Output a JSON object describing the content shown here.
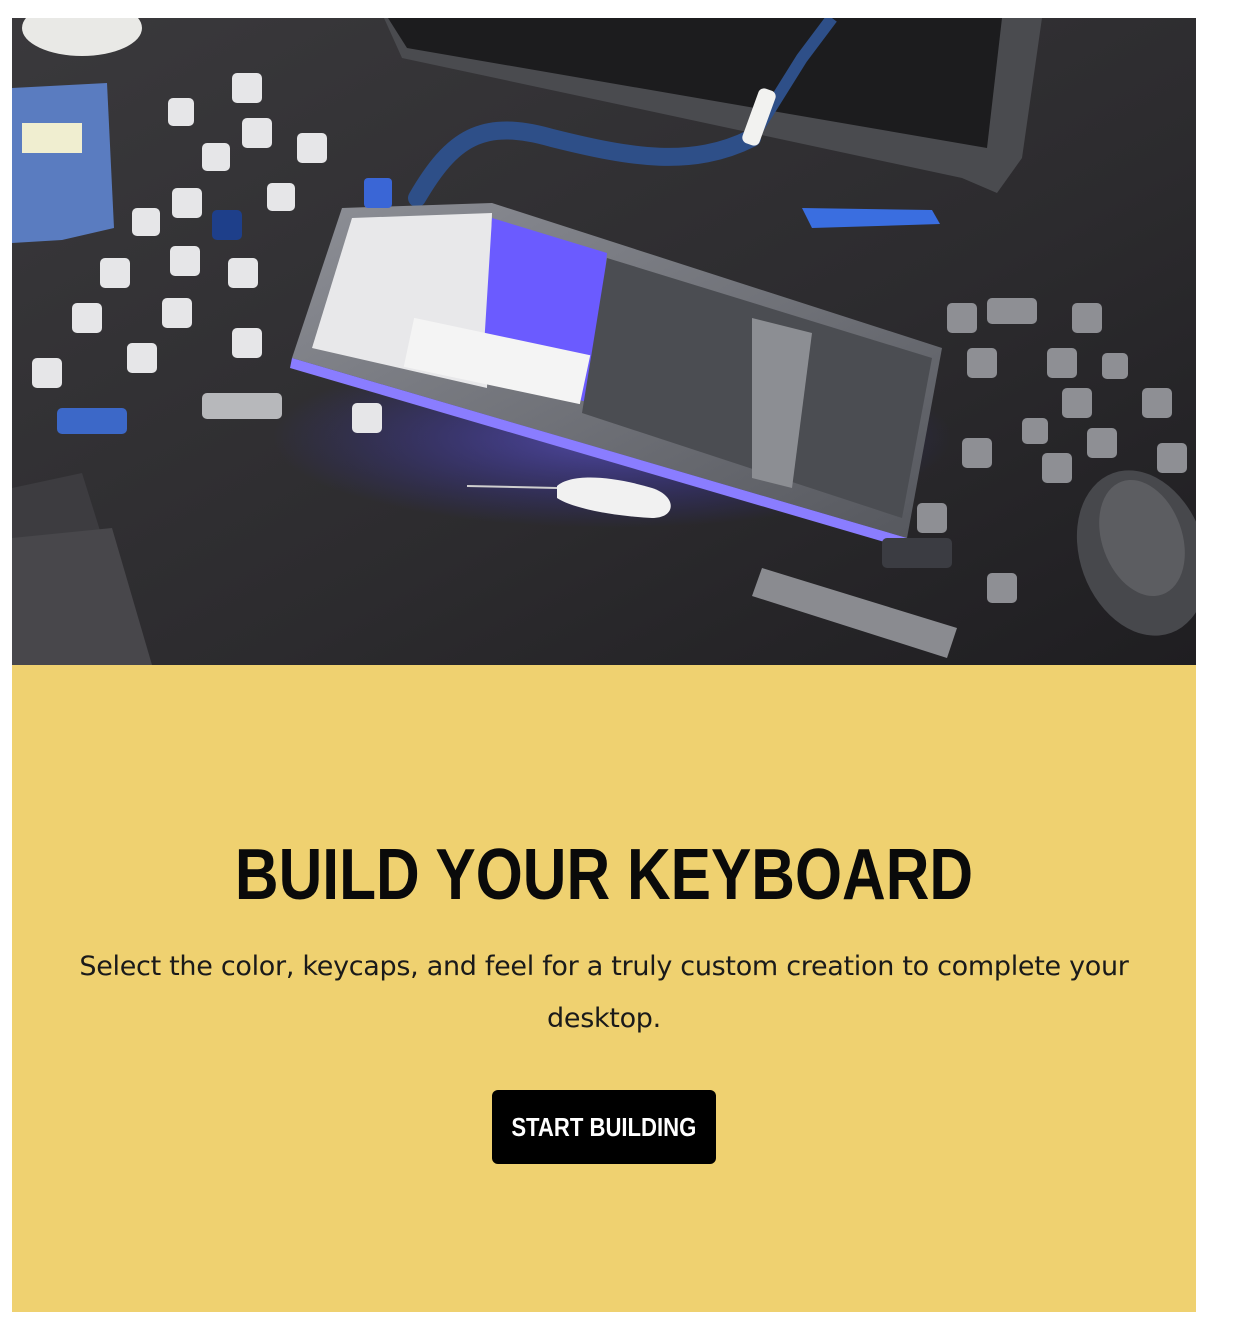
{
  "hero": {
    "image_alt": "Custom keyboard with keycaps, coiled cable and mouse on a dark desk"
  },
  "promo": {
    "headline": "BUILD YOUR KEYBOARD",
    "description": "Select the color, keycaps, and feel for a truly custom creation to complete your desktop.",
    "cta_label": "START BUILDING"
  },
  "colors": {
    "panel_background": "#efd170",
    "button_background": "#000000",
    "button_text": "#ffffff",
    "headline": "#0a0a0a"
  }
}
